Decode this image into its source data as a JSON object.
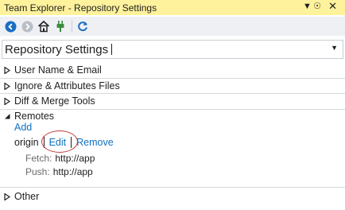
{
  "window": {
    "title": "Team Explorer - Repository Settings"
  },
  "titlebar": {
    "pin_glyph": "▼ ☉",
    "close_glyph": "✕"
  },
  "toolbar": {
    "icons": [
      "back-icon",
      "forward-icon",
      "home-icon",
      "connect-icon",
      "refresh-icon"
    ],
    "accent": "#1a6ec3"
  },
  "header": {
    "title": "Repository Settings",
    "dropdown_glyph": "▼"
  },
  "sections": [
    {
      "label": "User Name & Email",
      "expanded": false
    },
    {
      "label": "Ignore & Attributes Files",
      "expanded": false
    },
    {
      "label": "Diff & Merge Tools",
      "expanded": false
    },
    {
      "label": "Remotes",
      "expanded": true
    },
    {
      "label": "Other",
      "expanded": false
    }
  ],
  "remotes": {
    "add_label": "Add",
    "origin": {
      "name": "origin",
      "edit_label": "Edit",
      "remove_label": "Remove",
      "fetch_label": "Fetch:",
      "fetch_value": "http://app",
      "push_label": "Push:",
      "push_value": "http://app"
    }
  },
  "colors": {
    "titlebar_bg": "#fff29d",
    "link": "#0e70c0",
    "annotation_ring": "#c23a3a"
  }
}
